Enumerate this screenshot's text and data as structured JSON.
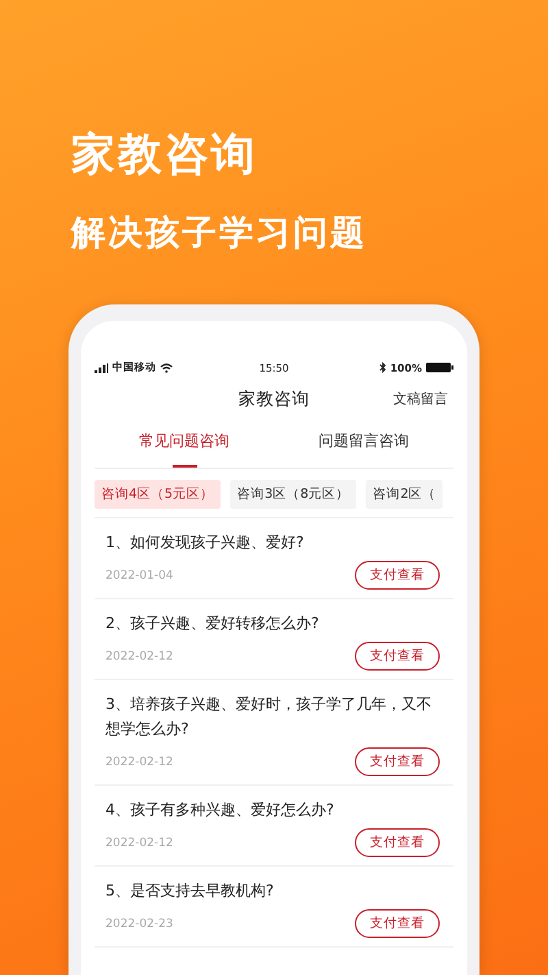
{
  "headline": "家教咨询",
  "subheadline": "解决孩子学习问题",
  "status_bar": {
    "carrier": "中国移动",
    "time": "15:50",
    "battery": "100%"
  },
  "nav": {
    "title": "家教咨询",
    "action": "文稿留言"
  },
  "tabs": [
    {
      "label": "常见问题咨询",
      "selected": true
    },
    {
      "label": "问题留言咨询",
      "selected": false
    }
  ],
  "chips": [
    {
      "label": "咨询4区（5元区）",
      "selected": true
    },
    {
      "label": "咨询3区（8元区）",
      "selected": false
    },
    {
      "label": "咨询2区（",
      "selected": false
    }
  ],
  "questions": [
    {
      "title": "1、如何发现孩子兴趣、爱好?",
      "date": "2022-01-04",
      "button": "支付查看"
    },
    {
      "title": "2、孩子兴趣、爱好转移怎么办?",
      "date": "2022-02-12",
      "button": "支付查看"
    },
    {
      "title": "3、培养孩子兴趣、爱好时，孩子学了几年，又不想学怎么办?",
      "date": "2022-02-12",
      "button": "支付查看"
    },
    {
      "title": "4、孩子有多种兴趣、爱好怎么办?",
      "date": "2022-02-12",
      "button": "支付查看"
    },
    {
      "title": "5、是否支持去早教机构?",
      "date": "2022-02-23",
      "button": "支付查看"
    }
  ]
}
